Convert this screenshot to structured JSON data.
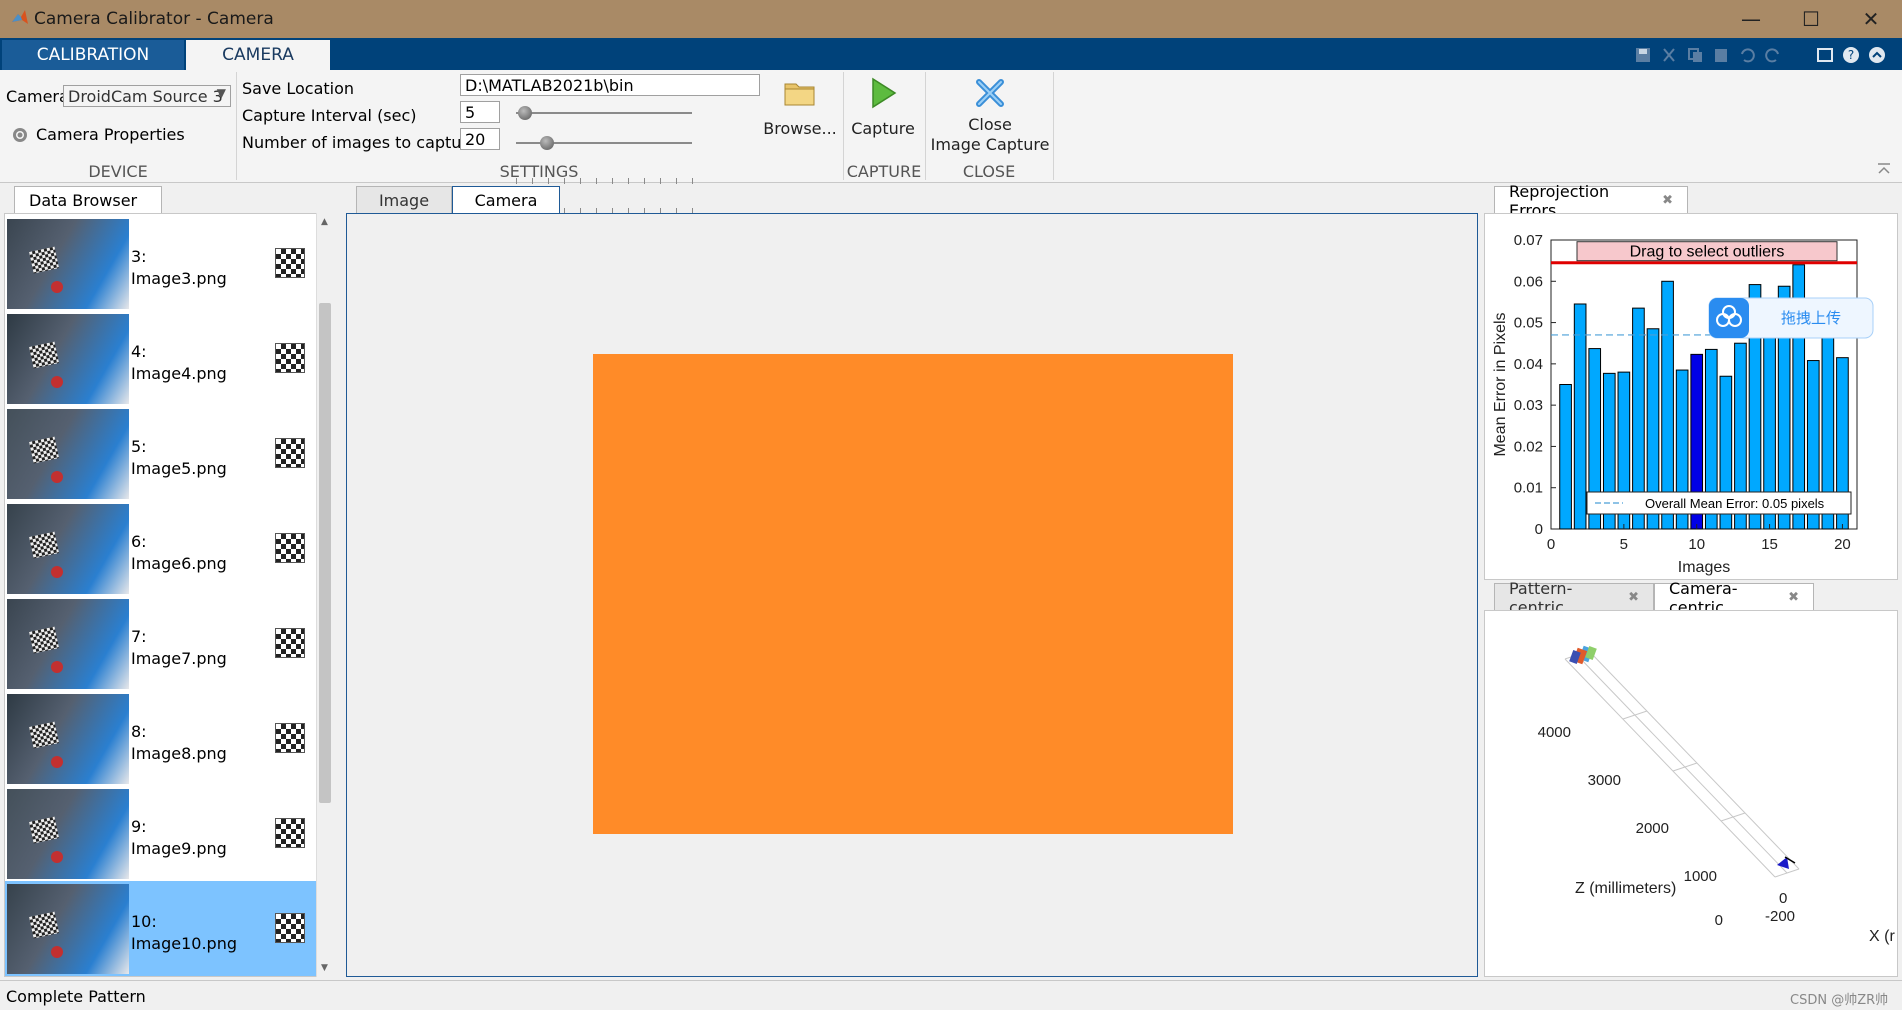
{
  "window": {
    "title": "Camera Calibrator - Camera",
    "minimize": "—",
    "maximize": "☐",
    "close": "✕"
  },
  "ribbon": {
    "tabs": [
      "CALIBRATION",
      "CAMERA"
    ]
  },
  "device": {
    "camera_label": "Camera",
    "camera_value": "DroidCam Source 3",
    "props_label": "Camera Properties",
    "section": "DEVICE"
  },
  "settings": {
    "save_location_label": "Save Location",
    "save_location_value": "D:\\MATLAB2021b\\bin",
    "interval_label": "Capture Interval (sec)",
    "interval_value": "5",
    "count_label": "Number of images to capture",
    "count_value": "20",
    "browse_label": "Browse...",
    "section": "SETTINGS"
  },
  "capture": {
    "label": "Capture",
    "section": "CAPTURE"
  },
  "close_section": {
    "line1": "Close",
    "line2": "Image Capture",
    "section": "CLOSE"
  },
  "data_browser": {
    "title": "Data Browser",
    "items": [
      {
        "num": "3:",
        "name": "Image3.png"
      },
      {
        "num": "4:",
        "name": "Image4.png"
      },
      {
        "num": "5:",
        "name": "Image5.png"
      },
      {
        "num": "6:",
        "name": "Image6.png"
      },
      {
        "num": "7:",
        "name": "Image7.png"
      },
      {
        "num": "8:",
        "name": "Image8.png"
      },
      {
        "num": "9:",
        "name": "Image9.png"
      },
      {
        "num": "10:",
        "name": "Image10.png"
      }
    ],
    "selected_index": 7
  },
  "main_tabs": [
    "Image",
    "Camera"
  ],
  "preview_color": "#ff8b28",
  "reproj_panel": {
    "title": "Reprojection Errors"
  },
  "chart_data": {
    "type": "bar",
    "xlabel": "Images",
    "ylabel": "Mean Error in Pixels",
    "ylim": [
      0,
      0.07
    ],
    "xlim": [
      0,
      21
    ],
    "yticks": [
      "0",
      "0.01",
      "0.02",
      "0.03",
      "0.04",
      "0.05",
      "0.06",
      "0.07"
    ],
    "xticks": [
      "0",
      "5",
      "10",
      "15",
      "20"
    ],
    "x": [
      1,
      2,
      3,
      4,
      5,
      6,
      7,
      8,
      9,
      10,
      11,
      12,
      13,
      14,
      15,
      16,
      17,
      18,
      19,
      20
    ],
    "values": [
      0.035,
      0.0545,
      0.0437,
      0.0377,
      0.038,
      0.0535,
      0.0485,
      0.06,
      0.0385,
      0.0423,
      0.0435,
      0.037,
      0.045,
      0.0592,
      0.0485,
      0.0588,
      0.064,
      0.0408,
      0.0553,
      0.0415
    ],
    "highlight_index": 9,
    "bar_color": "#00a8ff",
    "highlight_color": "#0000e6",
    "overall_mean": 0.047,
    "legend": "Overall Mean Error: 0.05 pixels",
    "drag_label": "Drag to select outliers",
    "overlay_label": "拖拽上传"
  },
  "extrinsics": {
    "tabs": [
      "Pattern-centric",
      "Camera-centric"
    ],
    "z_ticks": [
      "4000",
      "3000",
      "2000",
      "1000",
      "0"
    ],
    "x_ticks": [
      "0",
      "-200"
    ],
    "z_label": "Z (millimeters)",
    "x_label": "X (r"
  },
  "status": {
    "text": "Complete Pattern",
    "watermark": "CSDN @帅ZR帅"
  }
}
